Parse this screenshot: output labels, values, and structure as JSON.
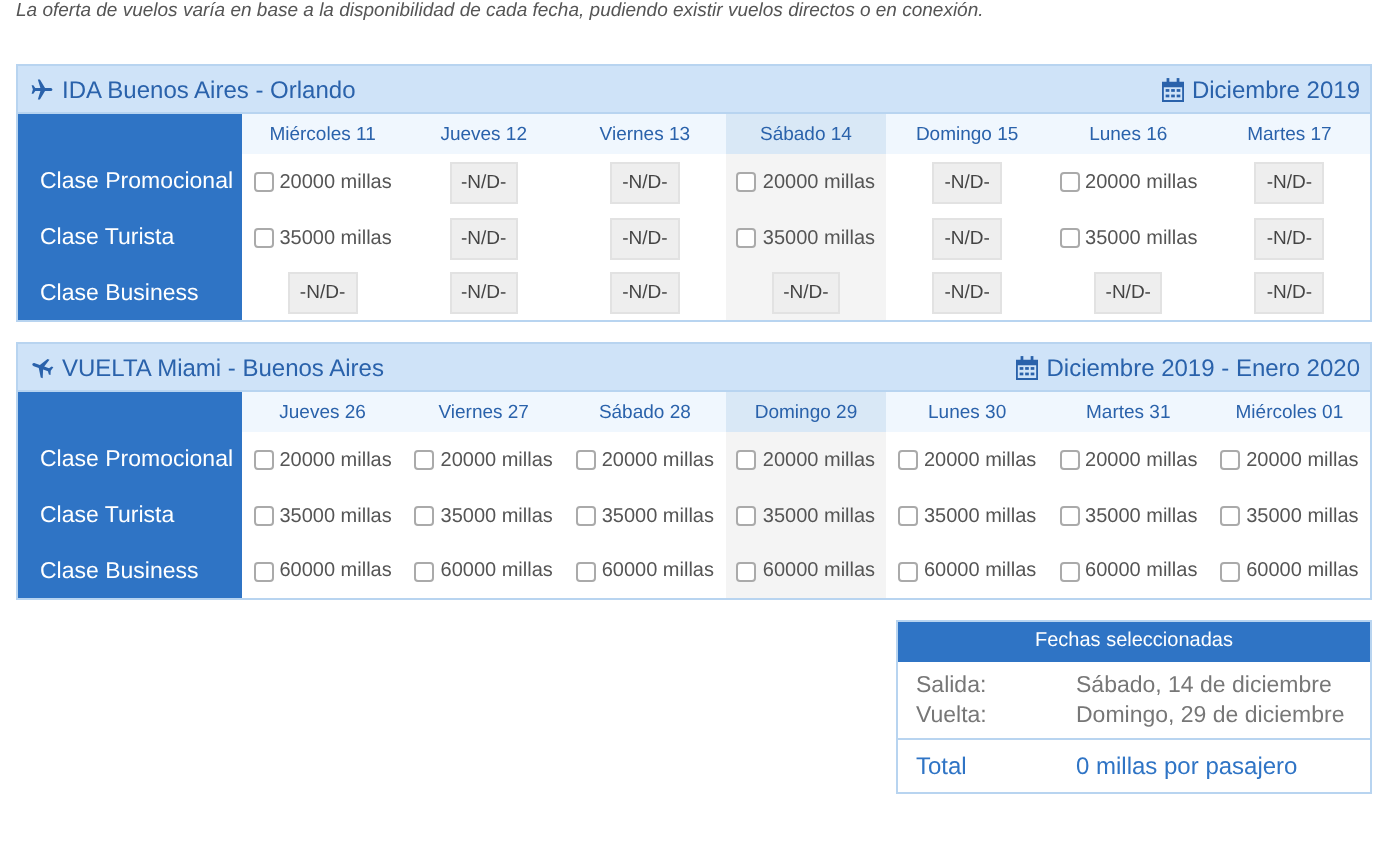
{
  "intro_note": "La oferta de vuelos varía en base a la disponibilidad de cada fecha, pudiendo existir vuelos directos o en conexión.",
  "flights": [
    {
      "kind": "outbound",
      "title": "IDA Buenos Aires - Orlando",
      "date_range": "Diciembre 2019",
      "days": [
        {
          "label": "Miércoles 11",
          "selected": false
        },
        {
          "label": "Jueves 12",
          "selected": false
        },
        {
          "label": "Viernes 13",
          "selected": false
        },
        {
          "label": "Sábado 14",
          "selected": true
        },
        {
          "label": "Domingo 15",
          "selected": false
        },
        {
          "label": "Lunes 16",
          "selected": false
        },
        {
          "label": "Martes 17",
          "selected": false
        }
      ],
      "classes": [
        {
          "name": "Clase Promocional",
          "cells": [
            {
              "kind": "option",
              "text": "20000 millas",
              "checked": false
            },
            {
              "kind": "na",
              "text": "-N/D-"
            },
            {
              "kind": "na",
              "text": "-N/D-"
            },
            {
              "kind": "option",
              "text": "20000 millas",
              "checked": false
            },
            {
              "kind": "na",
              "text": "-N/D-"
            },
            {
              "kind": "option",
              "text": "20000 millas",
              "checked": false
            },
            {
              "kind": "na",
              "text": "-N/D-"
            }
          ]
        },
        {
          "name": "Clase Turista",
          "cells": [
            {
              "kind": "option",
              "text": "35000 millas",
              "checked": false
            },
            {
              "kind": "na",
              "text": "-N/D-"
            },
            {
              "kind": "na",
              "text": "-N/D-"
            },
            {
              "kind": "option",
              "text": "35000 millas",
              "checked": false
            },
            {
              "kind": "na",
              "text": "-N/D-"
            },
            {
              "kind": "option",
              "text": "35000 millas",
              "checked": false
            },
            {
              "kind": "na",
              "text": "-N/D-"
            }
          ]
        },
        {
          "name": "Clase Business",
          "cells": [
            {
              "kind": "na",
              "text": "-N/D-"
            },
            {
              "kind": "na",
              "text": "-N/D-"
            },
            {
              "kind": "na",
              "text": "-N/D-"
            },
            {
              "kind": "na",
              "text": "-N/D-"
            },
            {
              "kind": "na",
              "text": "-N/D-"
            },
            {
              "kind": "na",
              "text": "-N/D-"
            },
            {
              "kind": "na",
              "text": "-N/D-"
            }
          ]
        }
      ]
    },
    {
      "kind": "return",
      "title": "VUELTA Miami - Buenos Aires",
      "date_range": "Diciembre 2019 - Enero 2020",
      "days": [
        {
          "label": "Jueves 26",
          "selected": false
        },
        {
          "label": "Viernes 27",
          "selected": false
        },
        {
          "label": "Sábado 28",
          "selected": false
        },
        {
          "label": "Domingo 29",
          "selected": true
        },
        {
          "label": "Lunes 30",
          "selected": false
        },
        {
          "label": "Martes 31",
          "selected": false
        },
        {
          "label": "Miércoles 01",
          "selected": false
        }
      ],
      "classes": [
        {
          "name": "Clase Promocional",
          "cells": [
            {
              "kind": "option",
              "text": "20000 millas",
              "checked": false
            },
            {
              "kind": "option",
              "text": "20000 millas",
              "checked": false
            },
            {
              "kind": "option",
              "text": "20000 millas",
              "checked": false
            },
            {
              "kind": "option",
              "text": "20000 millas",
              "checked": false
            },
            {
              "kind": "option",
              "text": "20000 millas",
              "checked": false
            },
            {
              "kind": "option",
              "text": "20000 millas",
              "checked": false
            },
            {
              "kind": "option",
              "text": "20000 millas",
              "checked": false
            }
          ]
        },
        {
          "name": "Clase Turista",
          "cells": [
            {
              "kind": "option",
              "text": "35000 millas",
              "checked": false
            },
            {
              "kind": "option",
              "text": "35000 millas",
              "checked": false
            },
            {
              "kind": "option",
              "text": "35000 millas",
              "checked": false
            },
            {
              "kind": "option",
              "text": "35000 millas",
              "checked": false
            },
            {
              "kind": "option",
              "text": "35000 millas",
              "checked": false
            },
            {
              "kind": "option",
              "text": "35000 millas",
              "checked": false
            },
            {
              "kind": "option",
              "text": "35000 millas",
              "checked": false
            }
          ]
        },
        {
          "name": "Clase Business",
          "cells": [
            {
              "kind": "option",
              "text": "60000 millas",
              "checked": false
            },
            {
              "kind": "option",
              "text": "60000 millas",
              "checked": false
            },
            {
              "kind": "option",
              "text": "60000 millas",
              "checked": false
            },
            {
              "kind": "option",
              "text": "60000 millas",
              "checked": false
            },
            {
              "kind": "option",
              "text": "60000 millas",
              "checked": false
            },
            {
              "kind": "option",
              "text": "60000 millas",
              "checked": false
            },
            {
              "kind": "option",
              "text": "60000 millas",
              "checked": false
            }
          ]
        }
      ]
    }
  ],
  "summary": {
    "title": "Fechas seleccionadas",
    "rows": [
      {
        "label": "Salida:",
        "value": "Sábado, 14 de diciembre"
      },
      {
        "label": "Vuelta:",
        "value": "Domingo, 29 de diciembre"
      }
    ],
    "total": {
      "label": "Total",
      "value": "0 millas por pasajero"
    }
  }
}
